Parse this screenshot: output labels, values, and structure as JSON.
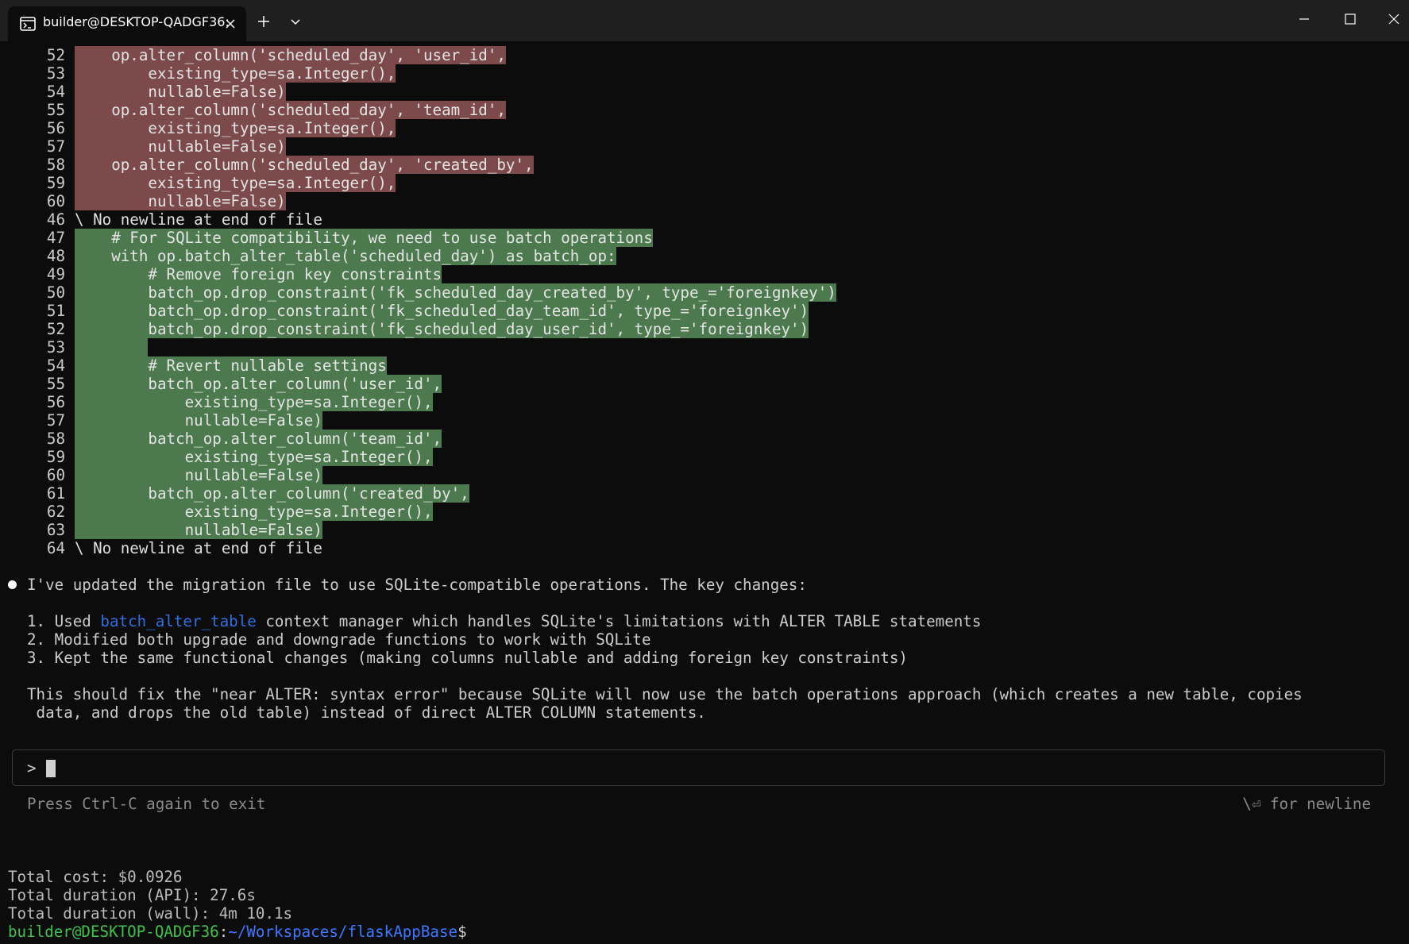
{
  "window": {
    "tab_title": "builder@DESKTOP-QADGF36: ",
    "icons": [
      "terminal-icon",
      "close-icon",
      "plus-icon",
      "chevron-down-icon",
      "minimize-icon",
      "maximize-icon",
      "close-icon"
    ]
  },
  "diff": {
    "removed": [
      {
        "num": "52",
        "text": "    op.alter_column('scheduled_day', 'user_id',"
      },
      {
        "num": "53",
        "text": "        existing_type=sa.Integer(),"
      },
      {
        "num": "54",
        "text": "        nullable=False)"
      },
      {
        "num": "55",
        "text": "    op.alter_column('scheduled_day', 'team_id',"
      },
      {
        "num": "56",
        "text": "        existing_type=sa.Integer(),"
      },
      {
        "num": "57",
        "text": "        nullable=False)"
      },
      {
        "num": "58",
        "text": "    op.alter_column('scheduled_day', 'created_by',"
      },
      {
        "num": "59",
        "text": "        existing_type=sa.Integer(),"
      },
      {
        "num": "60",
        "text": "        nullable=False)"
      }
    ],
    "removed_eof": {
      "num": "46",
      "text": "\\ No newline at end of file"
    },
    "added": [
      {
        "num": "47",
        "text": "    # For SQLite compatibility, we need to use batch operations"
      },
      {
        "num": "48",
        "text": "    with op.batch_alter_table('scheduled_day') as batch_op:"
      },
      {
        "num": "49",
        "text": "        # Remove foreign key constraints"
      },
      {
        "num": "50",
        "text": "        batch_op.drop_constraint('fk_scheduled_day_created_by', type_='foreignkey')"
      },
      {
        "num": "51",
        "text": "        batch_op.drop_constraint('fk_scheduled_day_team_id', type_='foreignkey')"
      },
      {
        "num": "52",
        "text": "        batch_op.drop_constraint('fk_scheduled_day_user_id', type_='foreignkey')"
      },
      {
        "num": "53",
        "text": "        "
      },
      {
        "num": "54",
        "text": "        # Revert nullable settings"
      },
      {
        "num": "55",
        "text": "        batch_op.alter_column('user_id',"
      },
      {
        "num": "56",
        "text": "            existing_type=sa.Integer(),"
      },
      {
        "num": "57",
        "text": "            nullable=False)"
      },
      {
        "num": "58",
        "text": "        batch_op.alter_column('team_id',"
      },
      {
        "num": "59",
        "text": "            existing_type=sa.Integer(),"
      },
      {
        "num": "60",
        "text": "            nullable=False)"
      },
      {
        "num": "61",
        "text": "        batch_op.alter_column('created_by',"
      },
      {
        "num": "62",
        "text": "            existing_type=sa.Integer(),"
      },
      {
        "num": "63",
        "text": "            nullable=False)"
      }
    ],
    "added_eof": {
      "num": "64",
      "text": "\\ No newline at end of file"
    }
  },
  "assistant": {
    "intro": "I've updated the migration file to use SQLite-compatible operations. The key changes:",
    "item1_prefix": "1. Used ",
    "item1_link": "batch_alter_table",
    "item1_suffix": " context manager which handles SQLite's limitations with ALTER TABLE statements",
    "item2": "2. Modified both upgrade and downgrade functions to work with SQLite",
    "item3": "3. Kept the same functional changes (making columns nullable and adding foreign key constraints)",
    "summary_line1": "This should fix the \"near ALTER: syntax error\" because SQLite will now use the batch operations approach (which creates a new table, copies",
    "summary_line2": " data, and drops the old table) instead of direct ALTER COLUMN statements."
  },
  "input": {
    "caret": ">",
    "value": ""
  },
  "hints": {
    "left": "Press Ctrl-C again to exit",
    "right": "\\⏎ for newline"
  },
  "stats": {
    "cost": "Total cost: $0.0926",
    "api": "Total duration (API): 27.6s",
    "wall": "Total duration (wall): 4m 10.1s"
  },
  "shell": {
    "user_host": "builder@DESKTOP-QADGF36",
    "separator": ":",
    "path": "~/Workspaces/flaskAppBase",
    "dollar": "$"
  }
}
